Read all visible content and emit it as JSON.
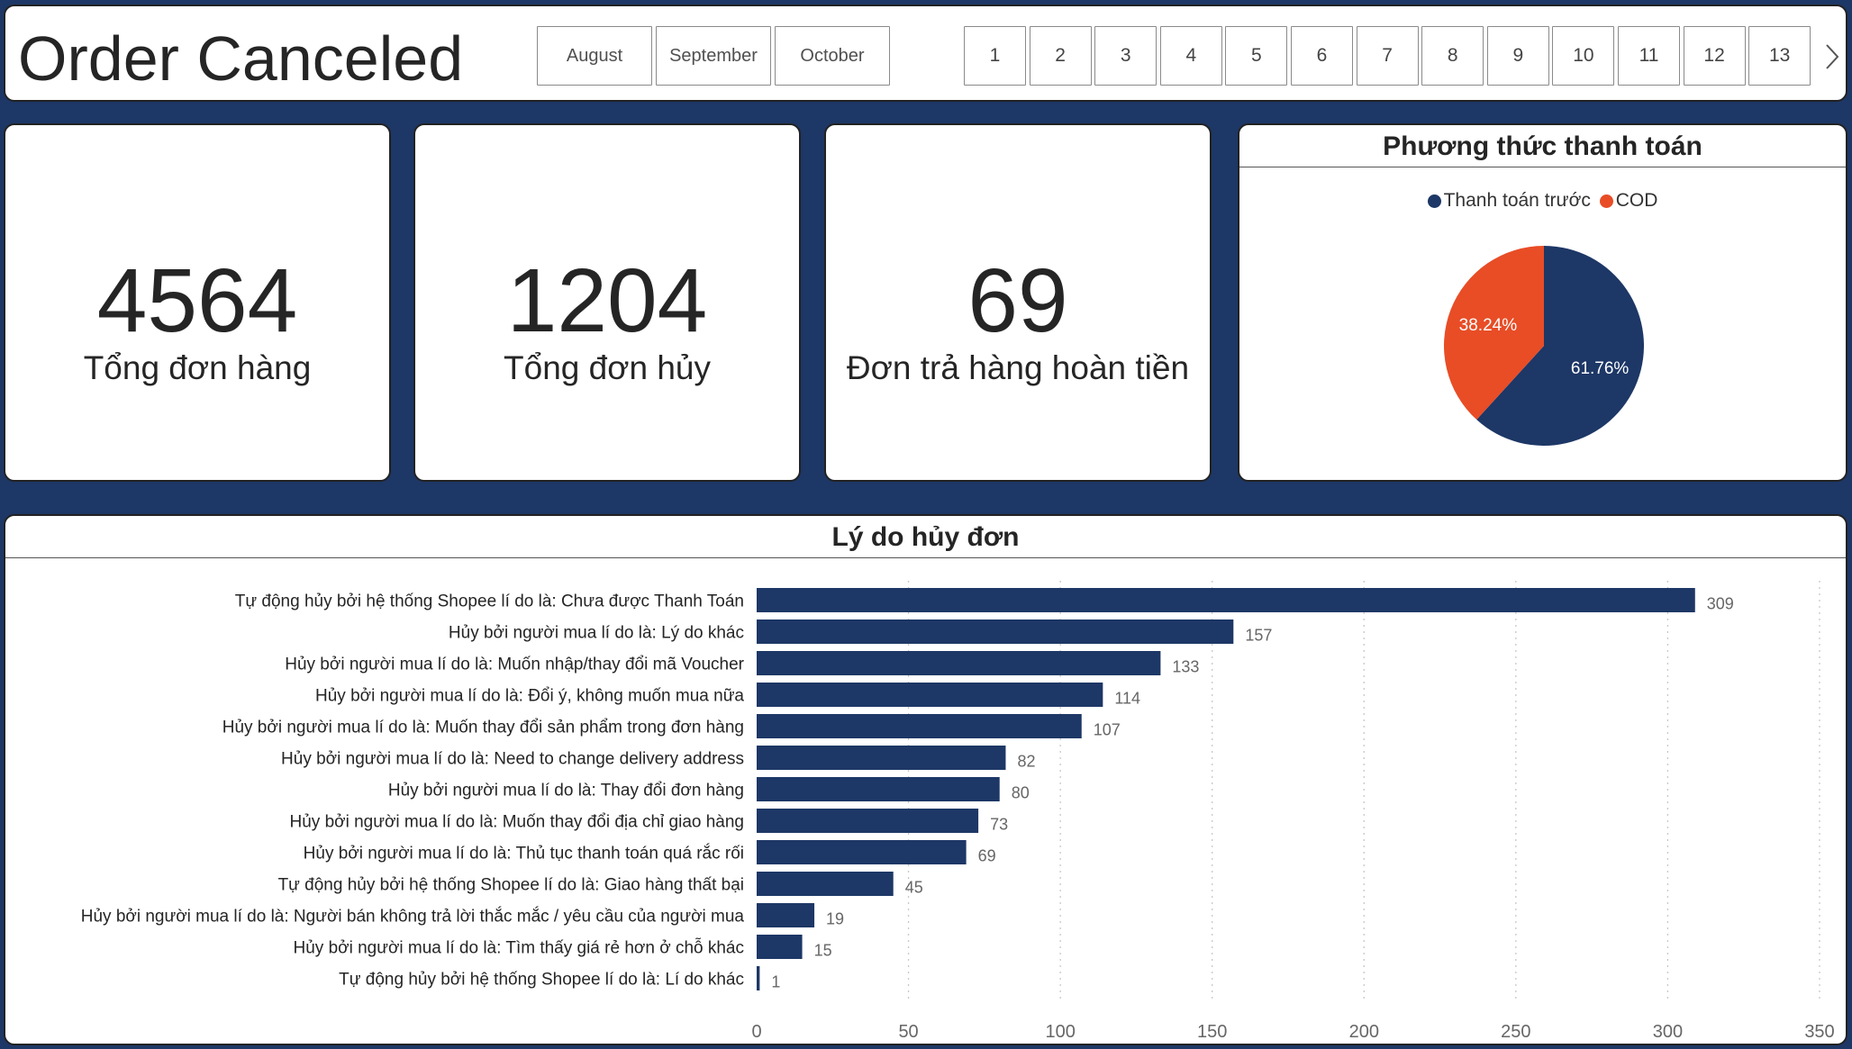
{
  "header": {
    "title": "Order Canceled",
    "months": [
      "August",
      "September",
      "October"
    ],
    "days": [
      "1",
      "2",
      "3",
      "4",
      "5",
      "6",
      "7",
      "8",
      "9",
      "10",
      "11",
      "12",
      "13"
    ],
    "next_icon": "chevron-right-icon"
  },
  "kpis": [
    {
      "value": "4564",
      "label": "Tổng đơn hàng"
    },
    {
      "value": "1204",
      "label": "Tổng đơn hủy"
    },
    {
      "value": "69",
      "label": "Đơn trả hàng hoàn tiền"
    }
  ],
  "payment": {
    "title": "Phương thức thanh toán",
    "legend": [
      {
        "label": "Thanh toán trước",
        "color": "#1d3766"
      },
      {
        "label": "COD",
        "color": "#e84d26"
      }
    ]
  },
  "reasons": {
    "title": "Lý do hủy đơn"
  },
  "chart_data": [
    {
      "type": "pie",
      "title": "Phương thức thanh toán",
      "categories": [
        "Thanh toán trước",
        "COD"
      ],
      "values": [
        61.76,
        38.24
      ],
      "labels": [
        "61.76%",
        "38.24%"
      ],
      "colors": [
        "#1d3766",
        "#e84d26"
      ],
      "legend": "top"
    },
    {
      "type": "bar",
      "orientation": "horizontal",
      "title": "Lý do hủy đơn",
      "categories": [
        "Tự động hủy bởi hệ thống Shopee lí do là: Chưa được Thanh Toán",
        "Hủy bởi người mua lí do là: Lý do khác",
        "Hủy bởi người mua lí do là: Muốn nhập/thay đổi mã Voucher",
        "Hủy bởi người mua lí do là: Đổi ý, không muốn mua nữa",
        "Hủy bởi người mua lí do là: Muốn thay đổi sản phẩm trong đơn hàng",
        "Hủy bởi người mua lí do là: Need to change delivery address",
        "Hủy bởi người mua lí do là: Thay đổi đơn hàng",
        "Hủy bởi người mua lí do là: Muốn thay đổi địa chỉ giao hàng",
        "Hủy bởi người mua lí do là: Thủ tục thanh toán quá rắc rối",
        "Tự động hủy bởi hệ thống Shopee lí do là: Giao hàng thất bại",
        "Hủy bởi người mua lí do là: Người bán không trả lời thắc mắc / yêu cầu của người mua",
        "Hủy bởi người mua lí do là: Tìm thấy giá rẻ hơn ở chỗ khác",
        "Tự động hủy bởi hệ thống Shopee lí do là: Lí do khác"
      ],
      "values": [
        309,
        157,
        133,
        114,
        107,
        82,
        80,
        73,
        69,
        45,
        19,
        15,
        1
      ],
      "xlim": [
        0,
        350
      ],
      "xticks": [
        0,
        50,
        100,
        150,
        200,
        250,
        300,
        350
      ],
      "bar_color": "#1d3766",
      "grid": true
    }
  ]
}
